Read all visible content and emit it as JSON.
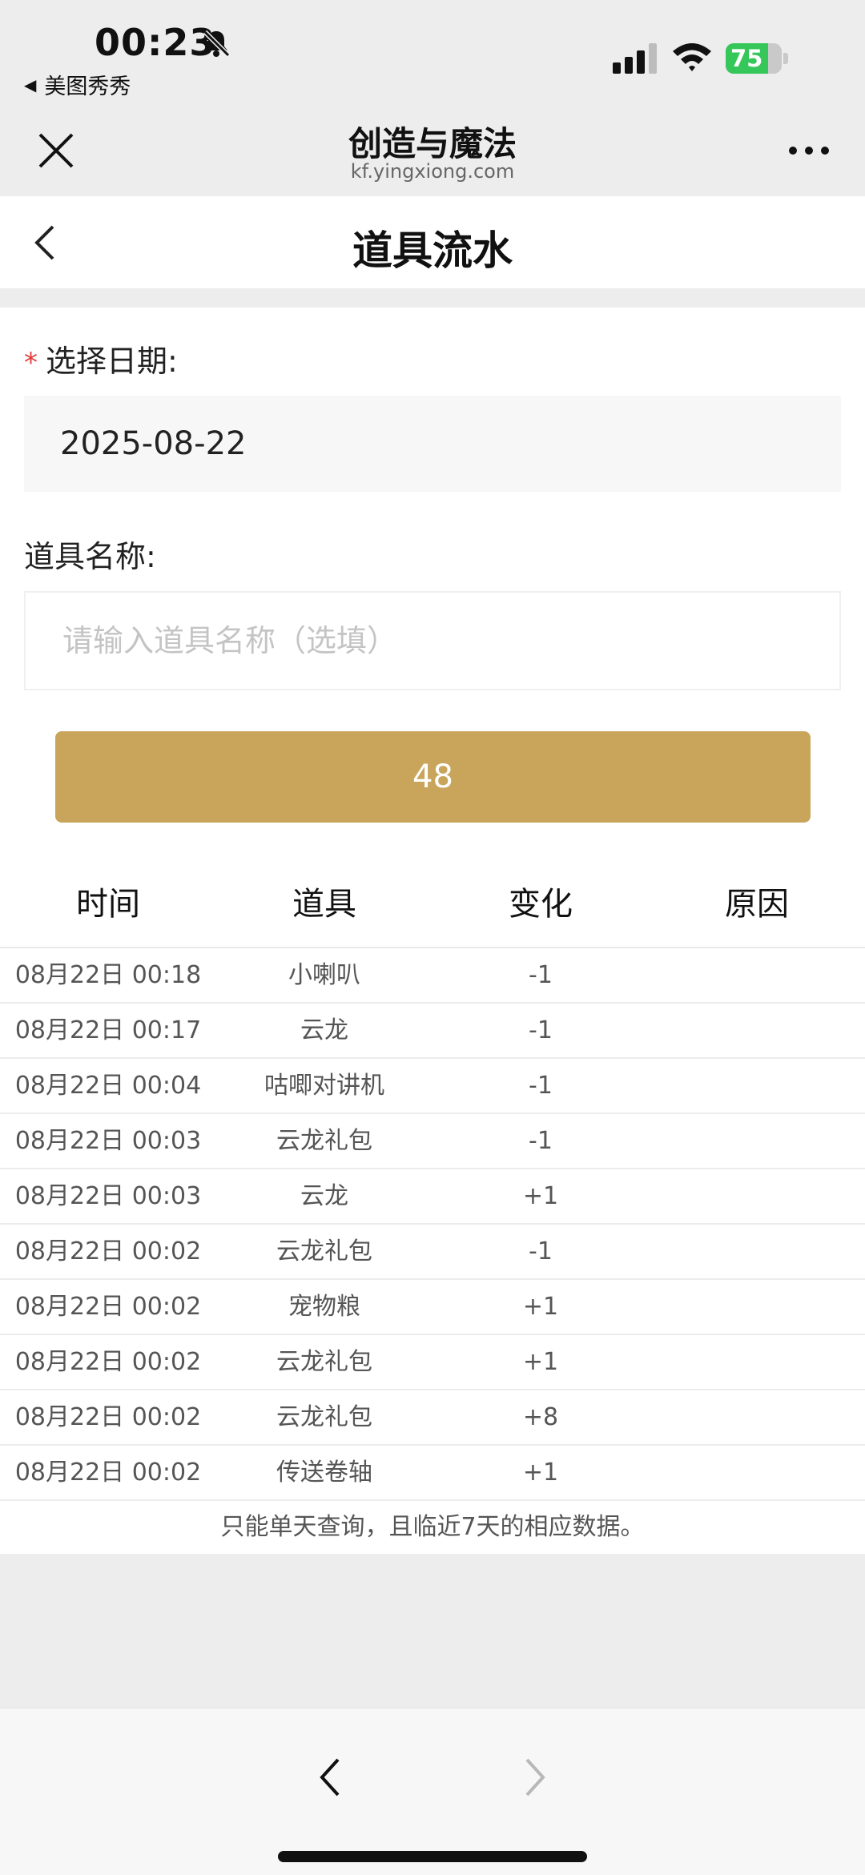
{
  "status_bar": {
    "time": "00:23",
    "back_app": "美图秀秀",
    "battery": "75",
    "battery_level": 0.75,
    "icons": [
      "bell-slash-icon",
      "signal-icon",
      "wifi-icon",
      "battery-charging-icon"
    ]
  },
  "browser": {
    "title": "创造与魔法",
    "url": "kf.yingxiong.com"
  },
  "page": {
    "title": "道具流水"
  },
  "form": {
    "date_required_mark": "*",
    "date_label": "选择日期:",
    "date_value": "2025-08-22",
    "item_label": "道具名称:",
    "item_placeholder": "请输入道具名称（选填）",
    "item_value": "",
    "query_button": "48"
  },
  "table": {
    "headers": [
      "时间",
      "道具",
      "变化",
      "原因"
    ],
    "rows": [
      {
        "time": "08月22日 00:18",
        "item": "小喇叭",
        "change": "-1",
        "reason": ""
      },
      {
        "time": "08月22日 00:17",
        "item": "云龙",
        "change": "-1",
        "reason": ""
      },
      {
        "time": "08月22日 00:04",
        "item": "咕唧对讲机",
        "change": "-1",
        "reason": ""
      },
      {
        "time": "08月22日 00:03",
        "item": "云龙礼包",
        "change": "-1",
        "reason": ""
      },
      {
        "time": "08月22日 00:03",
        "item": "云龙",
        "change": "+1",
        "reason": ""
      },
      {
        "time": "08月22日 00:02",
        "item": "云龙礼包",
        "change": "-1",
        "reason": ""
      },
      {
        "time": "08月22日 00:02",
        "item": "宠物粮",
        "change": "+1",
        "reason": ""
      },
      {
        "time": "08月22日 00:02",
        "item": "云龙礼包",
        "change": "+1",
        "reason": ""
      },
      {
        "time": "08月22日 00:02",
        "item": "云龙礼包",
        "change": "+8",
        "reason": ""
      },
      {
        "time": "08月22日 00:02",
        "item": "传送卷轴",
        "change": "+1",
        "reason": ""
      }
    ],
    "note": "只能单天查询，且临近7天的相应数据。"
  },
  "colors": {
    "accent": "#c9a55c",
    "required": "#e23c3c",
    "battery": "#35c759"
  }
}
